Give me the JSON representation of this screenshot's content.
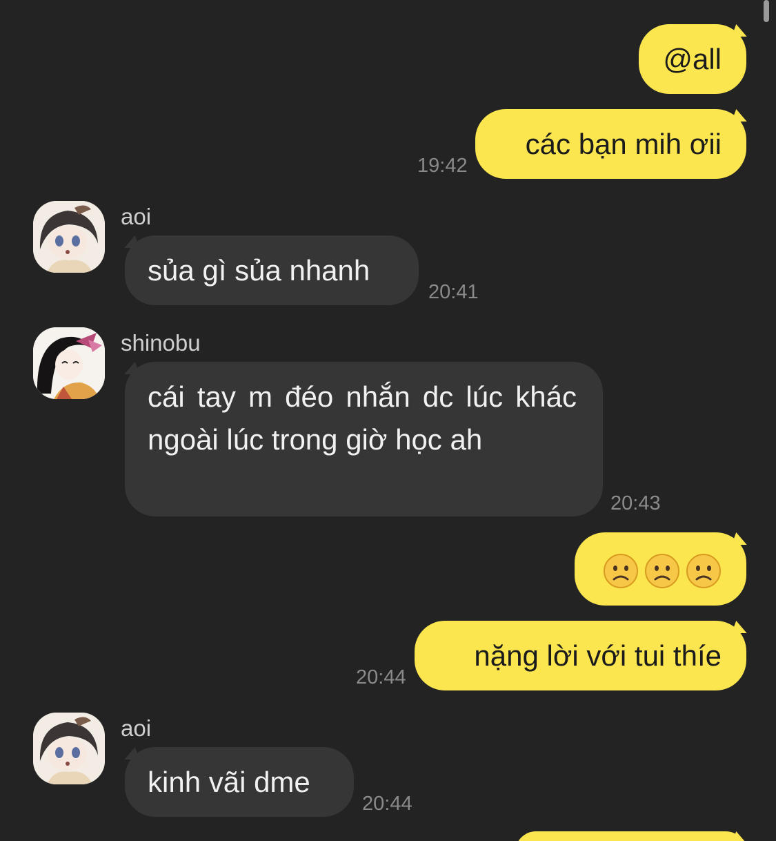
{
  "messages": {
    "m1": {
      "text": "@all"
    },
    "m2": {
      "text": "các bạn mih ơii",
      "time": "19:42"
    },
    "m3": {
      "sender": "aoi",
      "text": "sủa gì sủa nhanh",
      "time": "20:41"
    },
    "m4": {
      "sender": "shinobu",
      "text": "cái tay m đéo nhắn dc lúc khác ngoài lúc trong giờ học ah",
      "time": "20:43"
    },
    "m5": {
      "emoji": [
        "☹️",
        "☹️",
        "☹️"
      ],
      "emoji_icon": "frowning-face-icon"
    },
    "m6": {
      "text": "nặng lời với tui thíe",
      "time": "20:44"
    },
    "m7": {
      "sender": "aoi",
      "text": "kinh vãi dme",
      "time": "20:44"
    }
  },
  "colors": {
    "background": "#232323",
    "outgoing_bubble": "#fbe64f",
    "incoming_bubble": "#363636",
    "timestamp": "#8a8a8a"
  }
}
